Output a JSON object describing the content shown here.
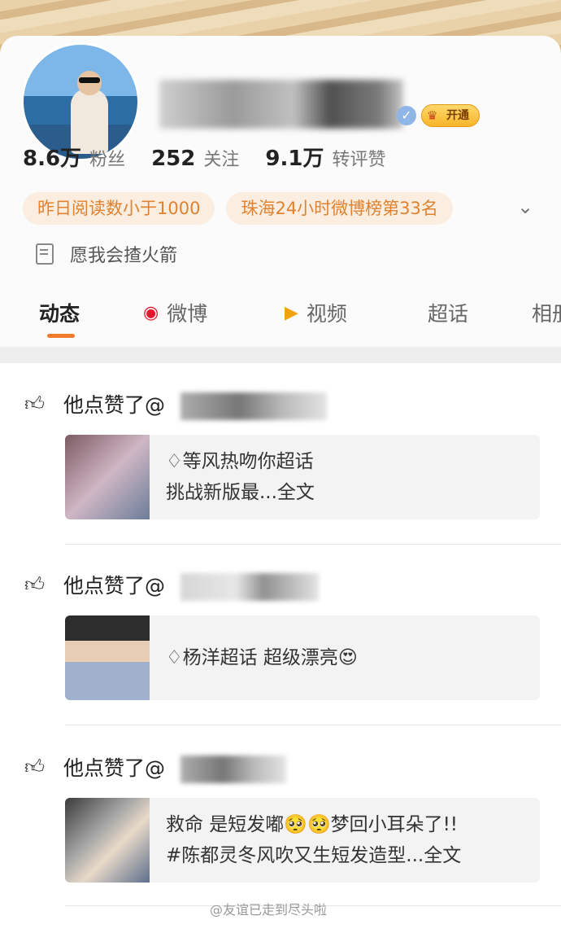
{
  "profile": {
    "vip_label": "开通",
    "stats": [
      {
        "num": "8.6万",
        "label": "粉丝"
      },
      {
        "num": "252",
        "label": "关注"
      },
      {
        "num": "9.1万",
        "label": "转评赞"
      }
    ],
    "badges": [
      "昨日阅读数小于1000",
      "珠海24小时微博榜第33名"
    ],
    "bio": "愿我会揸火箭"
  },
  "tabs": [
    {
      "label": "动态",
      "icon": ""
    },
    {
      "label": "微博",
      "icon": "weibo-icon"
    },
    {
      "label": "视频",
      "icon": "video-icon"
    },
    {
      "label": "超话",
      "icon": ""
    },
    {
      "label": "相册",
      "icon": ""
    }
  ],
  "feed": [
    {
      "action": "他点赞了@",
      "lines": [
        "♢等风热吻你超话",
        "挑战新版最...全文"
      ]
    },
    {
      "action": "他点赞了@",
      "lines": [
        "♢杨洋超话  超级漂亮😍"
      ]
    },
    {
      "action": "他点赞了@",
      "lines": [
        "救命 是短发嘟🥺🥺梦回小耳朵了!!",
        "#陈都灵冬风吹又生短发造型...全文"
      ]
    }
  ],
  "watermark": "@友谊已走到尽头啦",
  "colors": {
    "accent": "#f27c2e",
    "badge_bg": "#fbeee0",
    "badge_text": "#e0822f"
  }
}
